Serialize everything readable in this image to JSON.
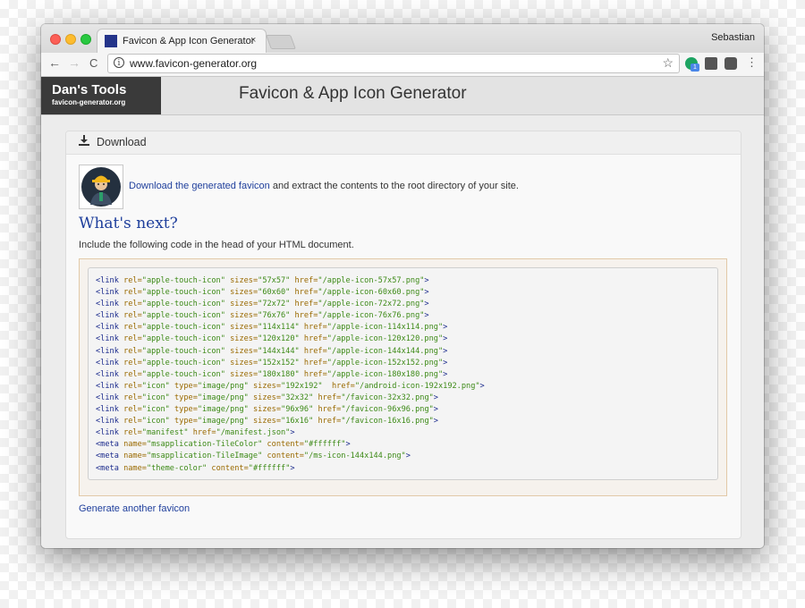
{
  "browser": {
    "tab_title": "Favicon & App Icon Generator",
    "tab_close": "×",
    "profile_name": "Sebastian",
    "url": "www.favicon-generator.org",
    "back_icon": "←",
    "forward_icon": "→",
    "reload_icon": "C",
    "info_icon": "i",
    "star_icon": "☆",
    "menu_icon": "⋮",
    "extension_badge": "1"
  },
  "site": {
    "logo_name": "Dan's Tools",
    "logo_url": "favicon-generator.org",
    "title": "Favicon & App Icon Generator"
  },
  "panel": {
    "header_label": "Download",
    "download_link": "Download the generated favicon",
    "download_rest": " and extract the contents to the root directory of your site.",
    "whats_next": "What's next?",
    "include_text": "Include the following code in the head of your HTML document.",
    "generate_another": "Generate another favicon"
  },
  "code_lines": [
    [
      [
        "t",
        "<link"
      ],
      [
        "p",
        " "
      ],
      [
        "a",
        "rel="
      ],
      [
        "s",
        "\"apple-touch-icon\""
      ],
      [
        "p",
        " "
      ],
      [
        "a",
        "sizes="
      ],
      [
        "s",
        "\"57x57\""
      ],
      [
        "p",
        " "
      ],
      [
        "a",
        "href="
      ],
      [
        "s",
        "\"/apple-icon-57x57.png\""
      ],
      [
        "t",
        ">"
      ]
    ],
    [
      [
        "t",
        "<link"
      ],
      [
        "p",
        " "
      ],
      [
        "a",
        "rel="
      ],
      [
        "s",
        "\"apple-touch-icon\""
      ],
      [
        "p",
        " "
      ],
      [
        "a",
        "sizes="
      ],
      [
        "s",
        "\"60x60\""
      ],
      [
        "p",
        " "
      ],
      [
        "a",
        "href="
      ],
      [
        "s",
        "\"/apple-icon-60x60.png\""
      ],
      [
        "t",
        ">"
      ]
    ],
    [
      [
        "t",
        "<link"
      ],
      [
        "p",
        " "
      ],
      [
        "a",
        "rel="
      ],
      [
        "s",
        "\"apple-touch-icon\""
      ],
      [
        "p",
        " "
      ],
      [
        "a",
        "sizes="
      ],
      [
        "s",
        "\"72x72\""
      ],
      [
        "p",
        " "
      ],
      [
        "a",
        "href="
      ],
      [
        "s",
        "\"/apple-icon-72x72.png\""
      ],
      [
        "t",
        ">"
      ]
    ],
    [
      [
        "t",
        "<link"
      ],
      [
        "p",
        " "
      ],
      [
        "a",
        "rel="
      ],
      [
        "s",
        "\"apple-touch-icon\""
      ],
      [
        "p",
        " "
      ],
      [
        "a",
        "sizes="
      ],
      [
        "s",
        "\"76x76\""
      ],
      [
        "p",
        " "
      ],
      [
        "a",
        "href="
      ],
      [
        "s",
        "\"/apple-icon-76x76.png\""
      ],
      [
        "t",
        ">"
      ]
    ],
    [
      [
        "t",
        "<link"
      ],
      [
        "p",
        " "
      ],
      [
        "a",
        "rel="
      ],
      [
        "s",
        "\"apple-touch-icon\""
      ],
      [
        "p",
        " "
      ],
      [
        "a",
        "sizes="
      ],
      [
        "s",
        "\"114x114\""
      ],
      [
        "p",
        " "
      ],
      [
        "a",
        "href="
      ],
      [
        "s",
        "\"/apple-icon-114x114.png\""
      ],
      [
        "t",
        ">"
      ]
    ],
    [
      [
        "t",
        "<link"
      ],
      [
        "p",
        " "
      ],
      [
        "a",
        "rel="
      ],
      [
        "s",
        "\"apple-touch-icon\""
      ],
      [
        "p",
        " "
      ],
      [
        "a",
        "sizes="
      ],
      [
        "s",
        "\"120x120\""
      ],
      [
        "p",
        " "
      ],
      [
        "a",
        "href="
      ],
      [
        "s",
        "\"/apple-icon-120x120.png\""
      ],
      [
        "t",
        ">"
      ]
    ],
    [
      [
        "t",
        "<link"
      ],
      [
        "p",
        " "
      ],
      [
        "a",
        "rel="
      ],
      [
        "s",
        "\"apple-touch-icon\""
      ],
      [
        "p",
        " "
      ],
      [
        "a",
        "sizes="
      ],
      [
        "s",
        "\"144x144\""
      ],
      [
        "p",
        " "
      ],
      [
        "a",
        "href="
      ],
      [
        "s",
        "\"/apple-icon-144x144.png\""
      ],
      [
        "t",
        ">"
      ]
    ],
    [
      [
        "t",
        "<link"
      ],
      [
        "p",
        " "
      ],
      [
        "a",
        "rel="
      ],
      [
        "s",
        "\"apple-touch-icon\""
      ],
      [
        "p",
        " "
      ],
      [
        "a",
        "sizes="
      ],
      [
        "s",
        "\"152x152\""
      ],
      [
        "p",
        " "
      ],
      [
        "a",
        "href="
      ],
      [
        "s",
        "\"/apple-icon-152x152.png\""
      ],
      [
        "t",
        ">"
      ]
    ],
    [
      [
        "t",
        "<link"
      ],
      [
        "p",
        " "
      ],
      [
        "a",
        "rel="
      ],
      [
        "s",
        "\"apple-touch-icon\""
      ],
      [
        "p",
        " "
      ],
      [
        "a",
        "sizes="
      ],
      [
        "s",
        "\"180x180\""
      ],
      [
        "p",
        " "
      ],
      [
        "a",
        "href="
      ],
      [
        "s",
        "\"/apple-icon-180x180.png\""
      ],
      [
        "t",
        ">"
      ]
    ],
    [
      [
        "t",
        "<link"
      ],
      [
        "p",
        " "
      ],
      [
        "a",
        "rel="
      ],
      [
        "s",
        "\"icon\""
      ],
      [
        "p",
        " "
      ],
      [
        "a",
        "type="
      ],
      [
        "s",
        "\"image/png\""
      ],
      [
        "p",
        " "
      ],
      [
        "a",
        "sizes="
      ],
      [
        "s",
        "\"192x192\""
      ],
      [
        "p",
        "  "
      ],
      [
        "a",
        "href="
      ],
      [
        "s",
        "\"/android-icon-192x192.png\""
      ],
      [
        "t",
        ">"
      ]
    ],
    [
      [
        "t",
        "<link"
      ],
      [
        "p",
        " "
      ],
      [
        "a",
        "rel="
      ],
      [
        "s",
        "\"icon\""
      ],
      [
        "p",
        " "
      ],
      [
        "a",
        "type="
      ],
      [
        "s",
        "\"image/png\""
      ],
      [
        "p",
        " "
      ],
      [
        "a",
        "sizes="
      ],
      [
        "s",
        "\"32x32\""
      ],
      [
        "p",
        " "
      ],
      [
        "a",
        "href="
      ],
      [
        "s",
        "\"/favicon-32x32.png\""
      ],
      [
        "t",
        ">"
      ]
    ],
    [
      [
        "t",
        "<link"
      ],
      [
        "p",
        " "
      ],
      [
        "a",
        "rel="
      ],
      [
        "s",
        "\"icon\""
      ],
      [
        "p",
        " "
      ],
      [
        "a",
        "type="
      ],
      [
        "s",
        "\"image/png\""
      ],
      [
        "p",
        " "
      ],
      [
        "a",
        "sizes="
      ],
      [
        "s",
        "\"96x96\""
      ],
      [
        "p",
        " "
      ],
      [
        "a",
        "href="
      ],
      [
        "s",
        "\"/favicon-96x96.png\""
      ],
      [
        "t",
        ">"
      ]
    ],
    [
      [
        "t",
        "<link"
      ],
      [
        "p",
        " "
      ],
      [
        "a",
        "rel="
      ],
      [
        "s",
        "\"icon\""
      ],
      [
        "p",
        " "
      ],
      [
        "a",
        "type="
      ],
      [
        "s",
        "\"image/png\""
      ],
      [
        "p",
        " "
      ],
      [
        "a",
        "sizes="
      ],
      [
        "s",
        "\"16x16\""
      ],
      [
        "p",
        " "
      ],
      [
        "a",
        "href="
      ],
      [
        "s",
        "\"/favicon-16x16.png\""
      ],
      [
        "t",
        ">"
      ]
    ],
    [
      [
        "t",
        "<link"
      ],
      [
        "p",
        " "
      ],
      [
        "a",
        "rel="
      ],
      [
        "s",
        "\"manifest\""
      ],
      [
        "p",
        " "
      ],
      [
        "a",
        "href="
      ],
      [
        "s",
        "\"/manifest.json\""
      ],
      [
        "t",
        ">"
      ]
    ],
    [
      [
        "t",
        "<meta"
      ],
      [
        "p",
        " "
      ],
      [
        "a",
        "name="
      ],
      [
        "s",
        "\"msapplication-TileColor\""
      ],
      [
        "p",
        " "
      ],
      [
        "a",
        "content="
      ],
      [
        "s",
        "\"#ffffff\""
      ],
      [
        "t",
        ">"
      ]
    ],
    [
      [
        "t",
        "<meta"
      ],
      [
        "p",
        " "
      ],
      [
        "a",
        "name="
      ],
      [
        "s",
        "\"msapplication-TileImage\""
      ],
      [
        "p",
        " "
      ],
      [
        "a",
        "content="
      ],
      [
        "s",
        "\"/ms-icon-144x144.png\""
      ],
      [
        "t",
        ">"
      ]
    ],
    [
      [
        "t",
        "<meta"
      ],
      [
        "p",
        " "
      ],
      [
        "a",
        "name="
      ],
      [
        "s",
        "\"theme-color\""
      ],
      [
        "p",
        " "
      ],
      [
        "a",
        "content="
      ],
      [
        "s",
        "\"#ffffff\""
      ],
      [
        "t",
        ">"
      ]
    ]
  ],
  "icons": [
    "download-icon",
    "avatar-icon",
    "info-icon",
    "star-icon",
    "extension-icon",
    "menu-icon"
  ],
  "colors": {
    "link": "#1f3f9c",
    "code_tag": "#1a2a8c",
    "code_attr": "#9a6a00",
    "code_string": "#3d8a17",
    "logo_bg": "#3a3a3a"
  }
}
